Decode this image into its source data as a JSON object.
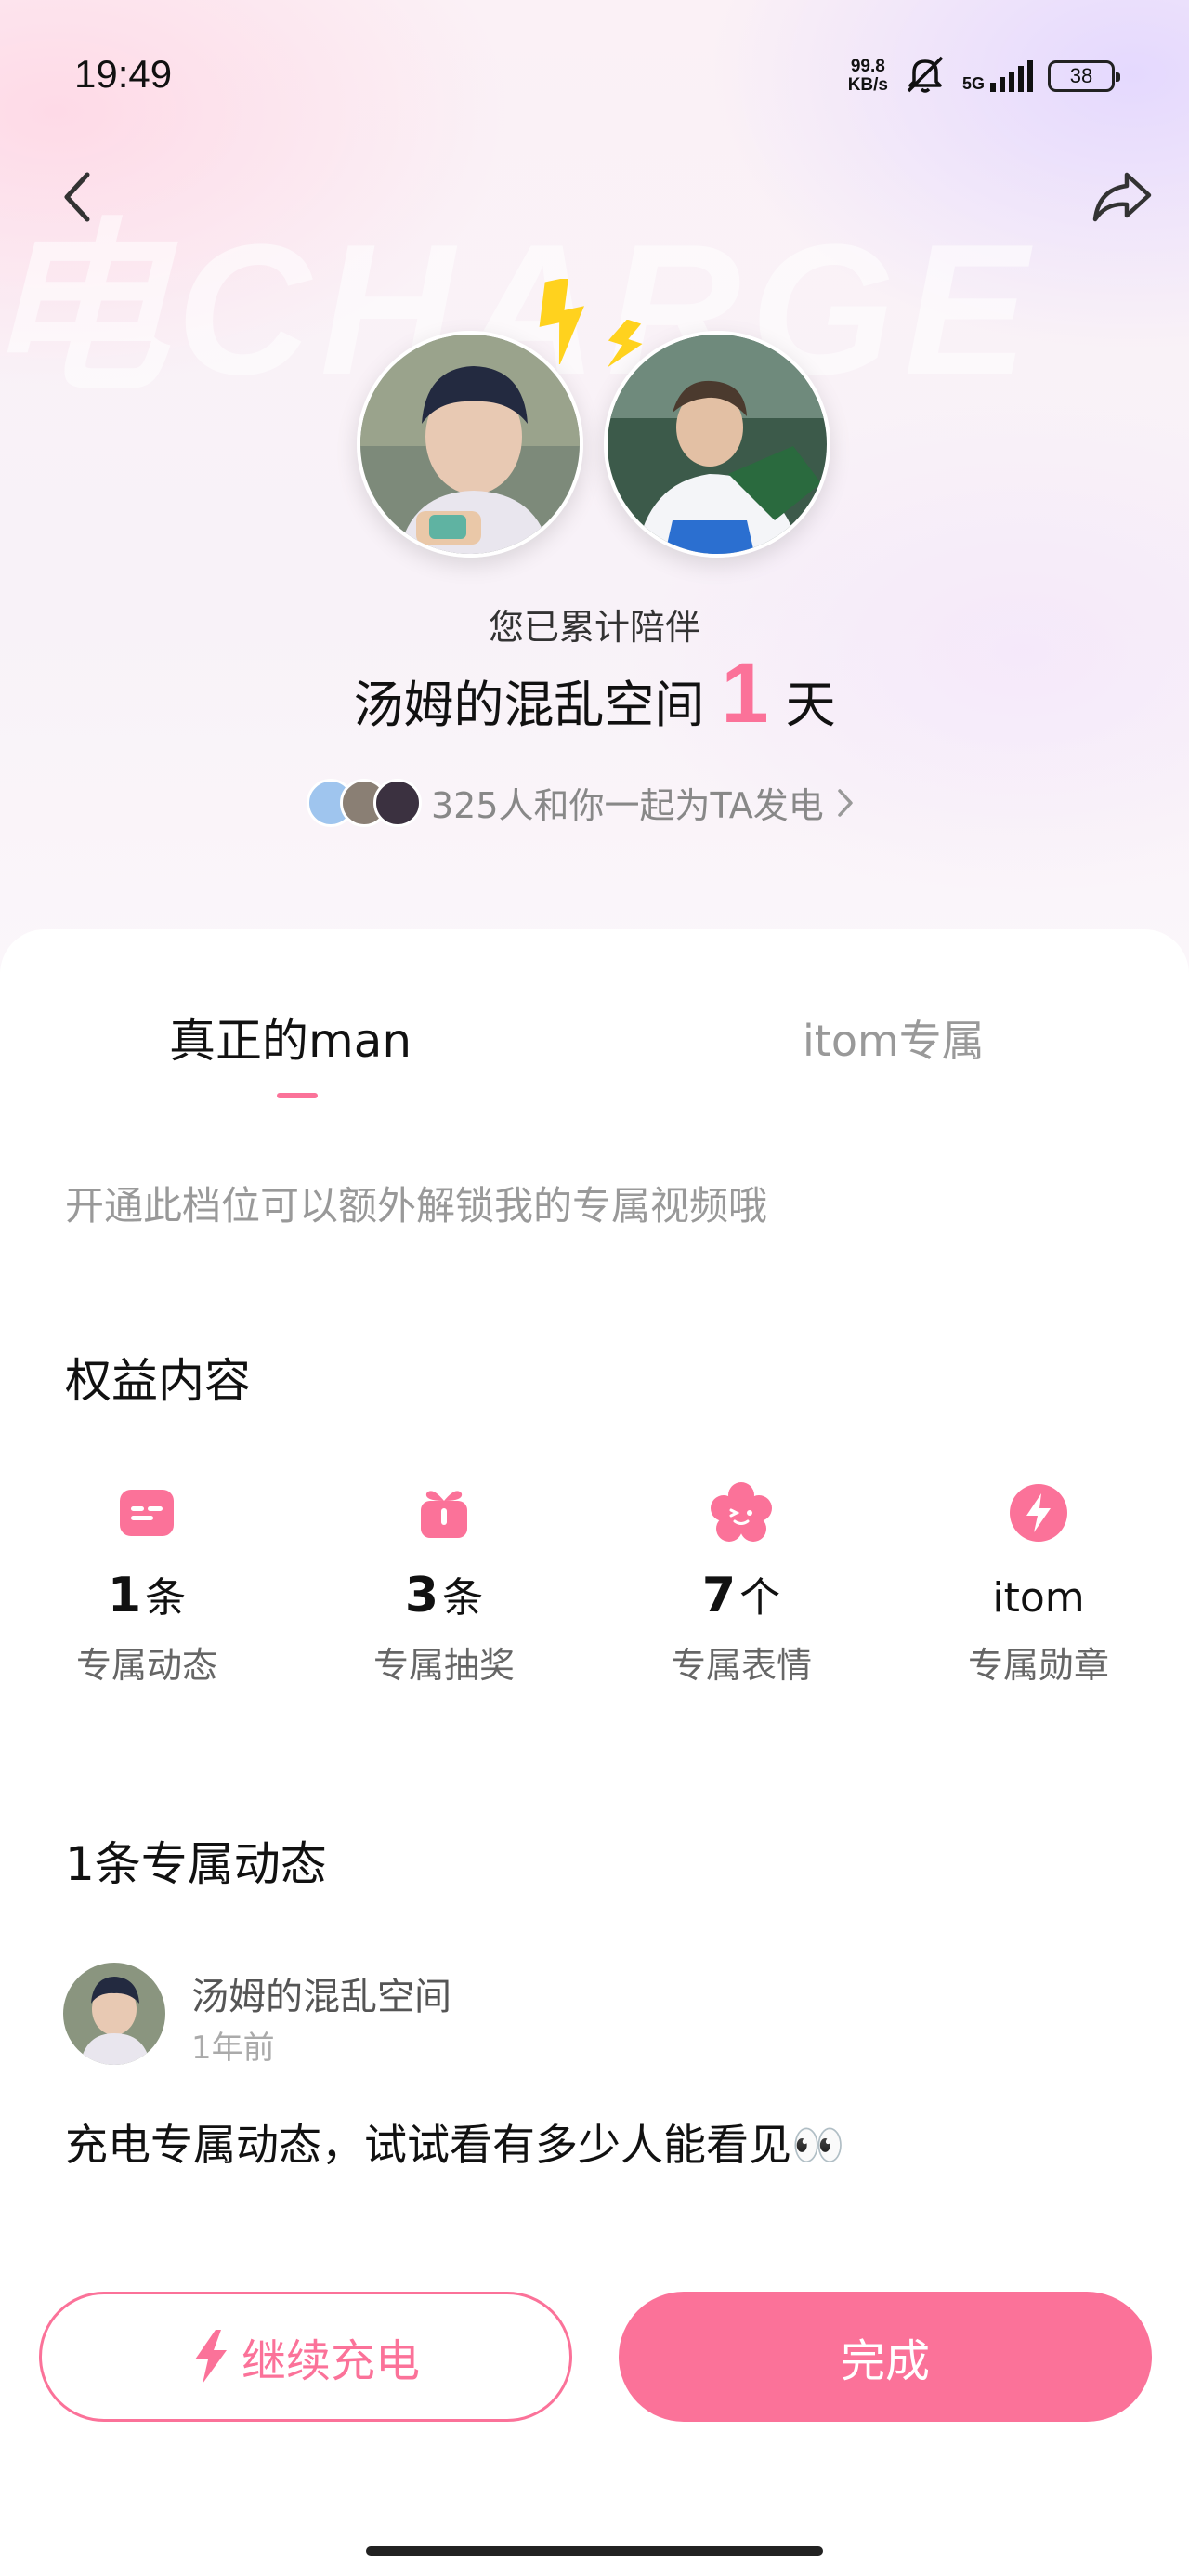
{
  "status_bar": {
    "time": "19:49",
    "net_speed_value": "99.8",
    "net_speed_unit": "KB/s",
    "signal_type": "5G",
    "battery": "38"
  },
  "hero": {
    "watermark": "电CHARGE",
    "accompany_label": "您已累计陪伴",
    "space_name": "汤姆的混乱空间",
    "days_count": "1",
    "days_unit": "天",
    "supporters_text": "325人和你一起为TA发电"
  },
  "tabs": [
    {
      "label": "真正的man",
      "active": true
    },
    {
      "label": "itom专属",
      "active": false
    }
  ],
  "tier_description": "开通此档位可以额外解锁我的专属视频哦",
  "benefits": {
    "title": "权益内容",
    "items": [
      {
        "icon": "message-card-icon",
        "count": "1",
        "unit": "条",
        "label": "专属动态"
      },
      {
        "icon": "gift-box-icon",
        "count": "3",
        "unit": "条",
        "label": "专属抽奖"
      },
      {
        "icon": "flower-emoji-icon",
        "count": "7",
        "unit": "个",
        "label": "专属表情"
      },
      {
        "icon": "lightning-badge-icon",
        "count": "",
        "unit": "itom",
        "label": "专属勋章"
      }
    ]
  },
  "posts_section": {
    "title": "1条专属动态",
    "post": {
      "author": "汤姆的混乱空间",
      "time": "1年前",
      "content": "充电专属动态，试试看有多少人能看见👀"
    }
  },
  "buttons": {
    "continue_label": "继续充电",
    "done_label": "完成"
  },
  "colors": {
    "accent": "#fb7299",
    "accent_light": "#ff8fb0",
    "lightning": "#ffd21e"
  }
}
